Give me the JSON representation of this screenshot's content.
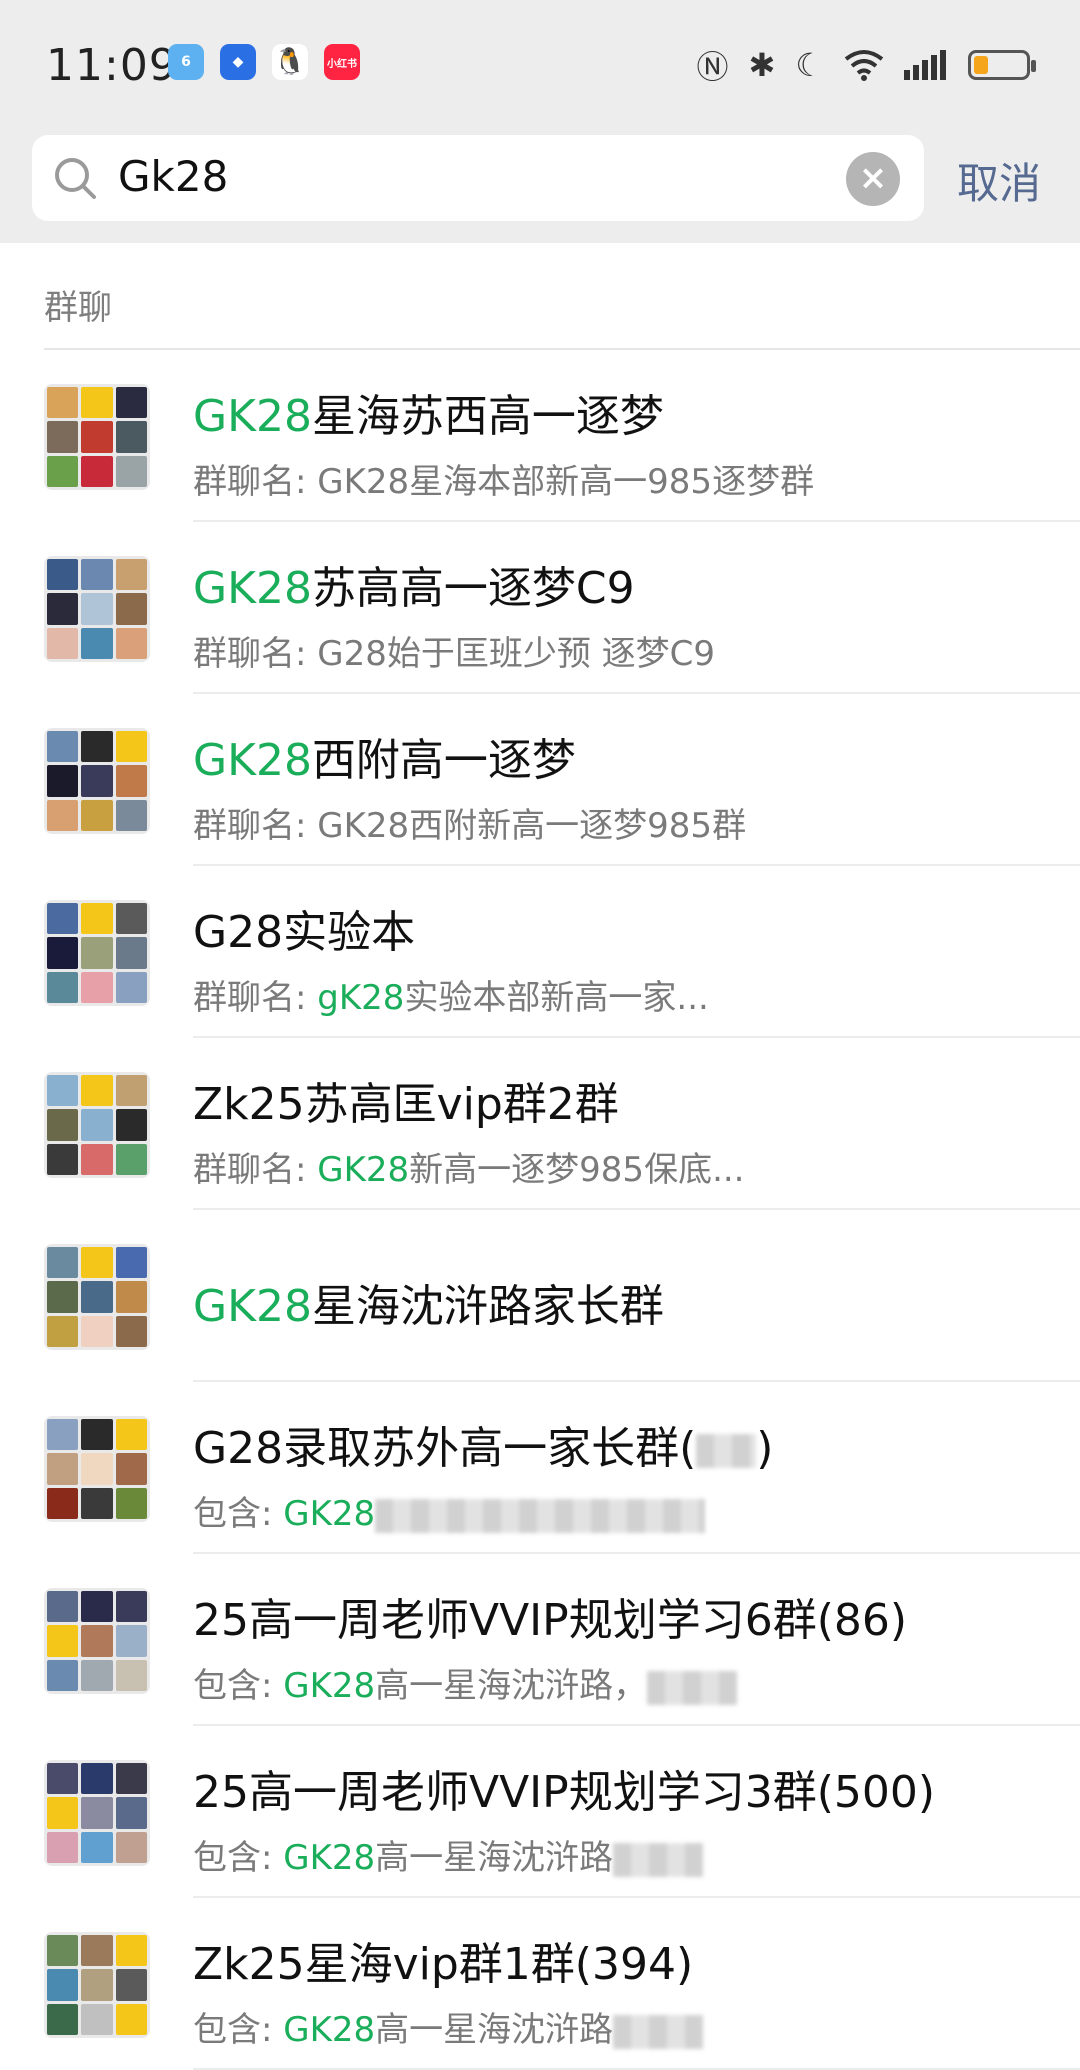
{
  "status_bar": {
    "time": "11:09",
    "apps": [
      {
        "name": "notification-app-1",
        "color": "#5db1f0",
        "glyph": "6"
      },
      {
        "name": "notification-app-2",
        "color": "#2a6fe3",
        "glyph": "◆"
      },
      {
        "name": "qq-icon",
        "color": "#111111",
        "glyph": "🐧"
      },
      {
        "name": "xiaohongshu-icon",
        "color": "#ff2442",
        "glyph": "小红书"
      }
    ],
    "system_icons": [
      "nfc-icon",
      "bluetooth-icon",
      "moon-icon",
      "wifi-icon",
      "signal-icon",
      "battery-icon"
    ],
    "battery_level": 0.25
  },
  "search": {
    "value": "Gk28",
    "cancel_label": "取消"
  },
  "section": {
    "label": "群聊"
  },
  "results": [
    {
      "title_hl": "GK28",
      "title_rest": "星海苏西高一逐梦",
      "sub_pre": "群聊名: GK28星海本部新高一985逐梦群",
      "sub_hl": "",
      "sub_post": ""
    },
    {
      "title_hl": "GK28",
      "title_rest": "苏高高一逐梦C9",
      "sub_pre": "群聊名: G28始于匡班少预 逐梦C9",
      "sub_hl": "",
      "sub_post": ""
    },
    {
      "title_hl": "GK28",
      "title_rest": "西附高一逐梦",
      "sub_pre": "群聊名: GK28西附新高一逐梦985群",
      "sub_hl": "",
      "sub_post": ""
    },
    {
      "title_hl": "",
      "title_rest": "G28实验本",
      "sub_pre": "群聊名: ",
      "sub_hl": "gK28",
      "sub_post": "实验本部新高一家..."
    },
    {
      "title_hl": "",
      "title_rest": "Zk25苏高匡vip群2群",
      "sub_pre": "群聊名: ",
      "sub_hl": "GK28",
      "sub_post": "新高一逐梦985保底..."
    },
    {
      "title_hl": "GK28",
      "title_rest": "星海沈浒路家长群",
      "sub_pre": "",
      "sub_hl": "",
      "sub_post": ""
    },
    {
      "title_hl": "",
      "title_rest": "G28录取苏外高一家长群(",
      "title_tail": ")",
      "sub_pre": "包含: ",
      "sub_hl": "GK28",
      "sub_post": ""
    },
    {
      "title_hl": "",
      "title_rest": "25高一周老师VVIP规划学习6群(86)",
      "sub_pre": "包含: ",
      "sub_hl": "GK28",
      "sub_post": "高一星海沈浒路，"
    },
    {
      "title_hl": "",
      "title_rest": "25高一周老师VVIP规划学习3群(500)",
      "sub_pre": "包含: ",
      "sub_hl": "GK28",
      "sub_post": "高一星海沈浒路"
    },
    {
      "title_hl": "",
      "title_rest": "Zk25星海vip群1群(394)",
      "sub_pre": "包含: ",
      "sub_hl": "GK28",
      "sub_post": "高一星海沈浒路"
    }
  ],
  "colors": {
    "highlight": "#1aad5a",
    "cancel": "#566a91",
    "header_bg": "#ededed"
  }
}
